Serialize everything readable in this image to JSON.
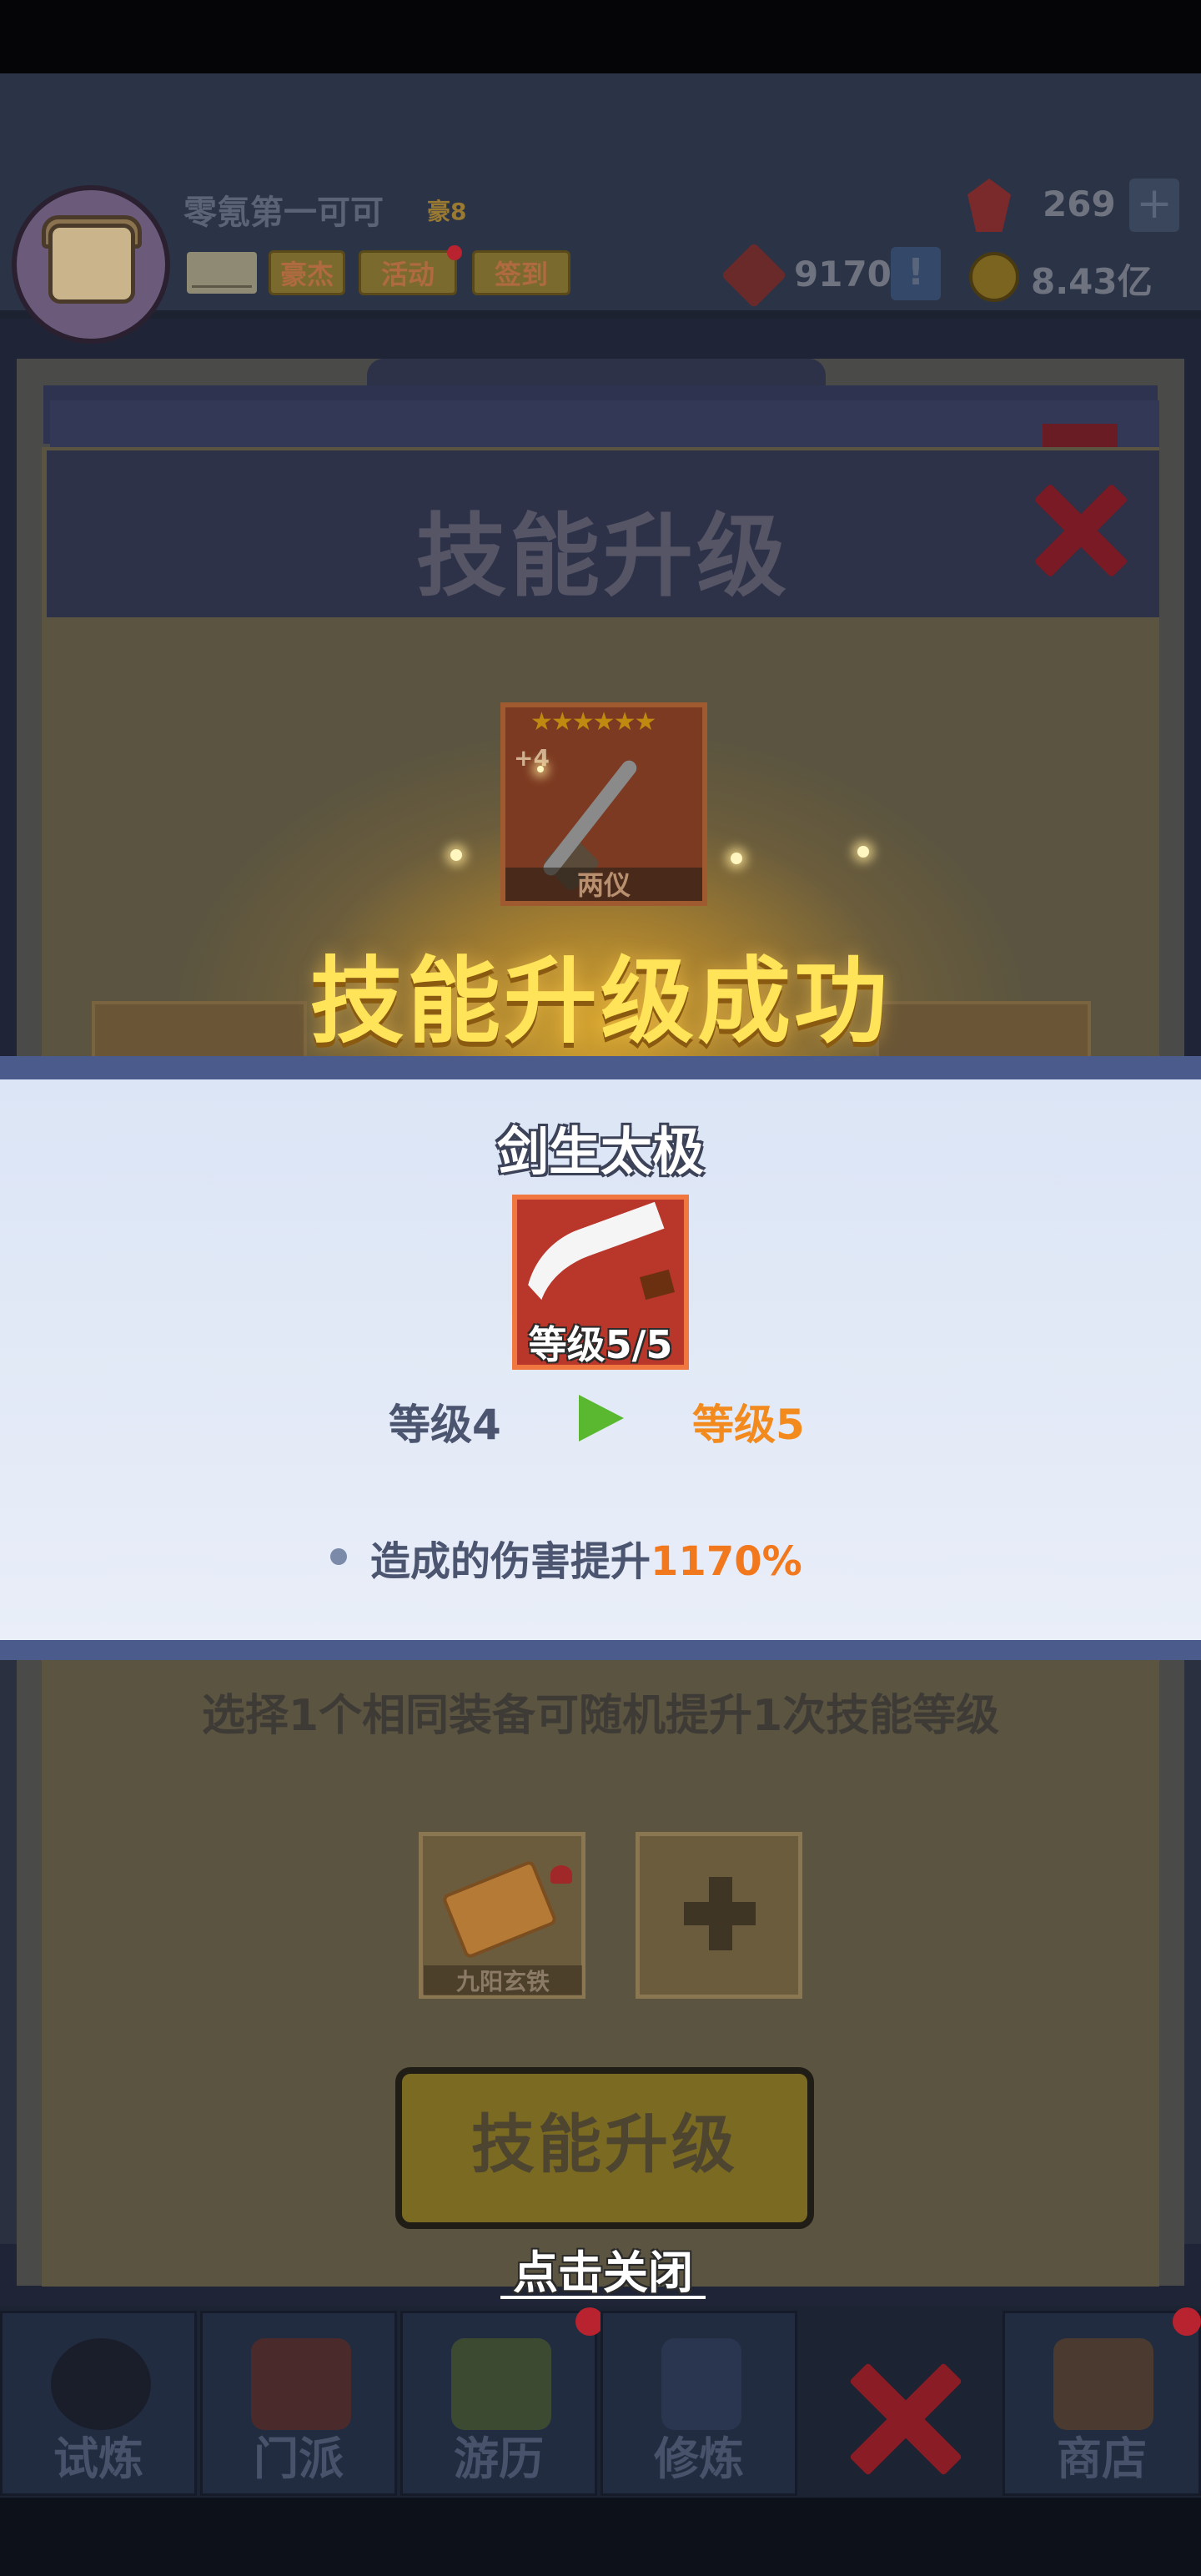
{
  "header": {
    "player_name": "零氪第一可可",
    "vip_label": "豪8",
    "buttons": [
      {
        "label": "豪杰"
      },
      {
        "label": "活动"
      },
      {
        "label": "签到"
      }
    ],
    "ruby_count": "269",
    "ruby_plus": "+",
    "token_count": "9170",
    "token_excl": "!",
    "coin_count": "8.43亿"
  },
  "dialog": {
    "title": "技能升级",
    "item_card": {
      "stars": "★★★★★★",
      "plus": "+4",
      "name": "两仪"
    },
    "success_text": "技能升级成功",
    "instruction": "选择1个相同装备可随机提升1次技能等级",
    "slot_item_name": "九阳玄铁",
    "upgrade_button": "技能升级",
    "tap_close": "点击关闭"
  },
  "result": {
    "skill_name": "剑生太极",
    "level_badge": "等级5/5",
    "level_from": "等级4",
    "level_to": "等级5",
    "effect_label": "造成的伤害提升",
    "effect_value": "1170%"
  },
  "nav": {
    "tabs": [
      {
        "label": "试炼"
      },
      {
        "label": "门派"
      },
      {
        "label": "游历"
      },
      {
        "label": "修炼"
      },
      {
        "label": ""
      },
      {
        "label": "商店"
      }
    ]
  },
  "colors": {
    "success_yellow": "#ffe45a",
    "level_to_orange": "#f28a1e",
    "arrow_green": "#5ab830",
    "banner_edge": "#4b5b8c"
  }
}
